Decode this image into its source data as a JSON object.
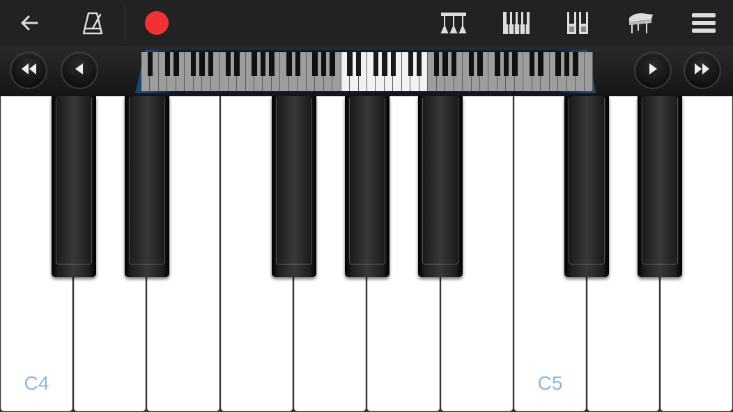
{
  "toolbar": {
    "icons": [
      "back-arrow-icon",
      "metronome-icon",
      "record-icon",
      "chord-icon",
      "keyboard-layout-icon",
      "dual-keyboard-icon",
      "grand-piano-icon",
      "menu-icon"
    ],
    "record_color": "#f23232"
  },
  "navigator": {
    "icons": [
      "rewind-icon",
      "step-left-icon",
      "step-right-icon",
      "fast-forward-icon"
    ]
  },
  "keyboard": {
    "labels": {
      "C4": "C4",
      "C5": "C5"
    },
    "label_color": "#8ab8e0"
  }
}
